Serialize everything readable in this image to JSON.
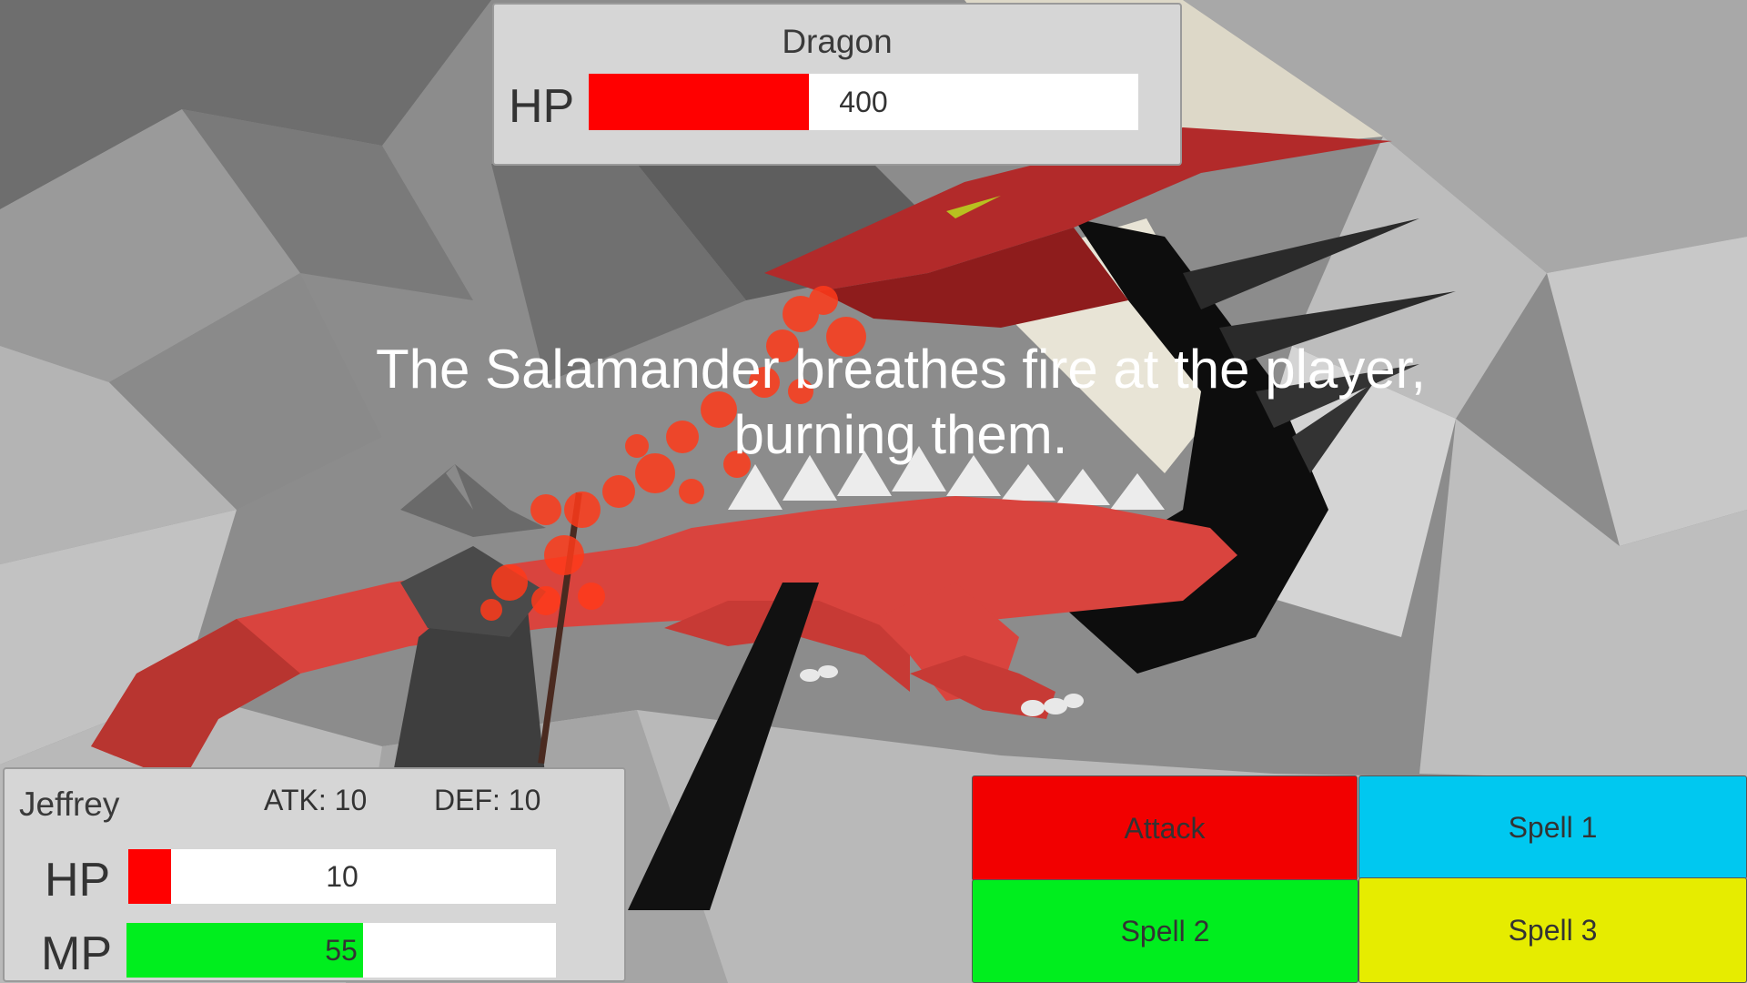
{
  "enemy": {
    "name": "Dragon",
    "hp_label": "HP",
    "hp_value": "400",
    "hp_fraction": 0.4,
    "hp_color": "#ff0000"
  },
  "message": {
    "line1": "The Salamander breathes fire at the player,",
    "line2": "burning them."
  },
  "player": {
    "name": "Jeffrey",
    "atk": "ATK: 10",
    "def": "DEF: 10",
    "hp_label": "HP",
    "hp_value": "10",
    "hp_fraction": 0.1,
    "hp_color": "#ff0000",
    "mp_label": "MP",
    "mp_value": "55",
    "mp_fraction": 0.55,
    "mp_color": "#00ee1e"
  },
  "actions": [
    {
      "label": "Attack",
      "color": "#f20000"
    },
    {
      "label": "Spell 1",
      "color": "#00c8f0"
    },
    {
      "label": "Spell 2",
      "color": "#00ee1e"
    },
    {
      "label": "Spell 3",
      "color": "#e6ec00"
    }
  ]
}
